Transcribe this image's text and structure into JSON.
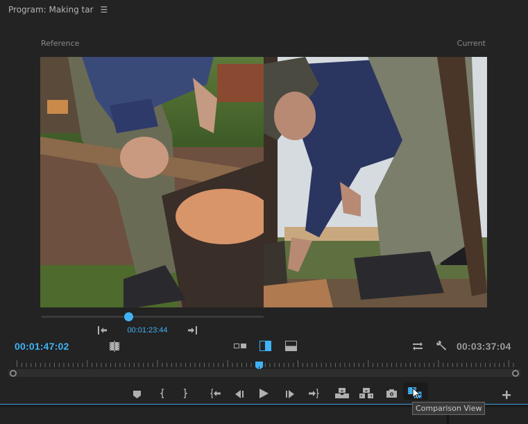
{
  "panel": {
    "title": "Program: Making tar",
    "menu_icon": "hamburger-menu-icon"
  },
  "comparison": {
    "reference_label": "Reference",
    "current_label": "Current",
    "reference_timecode": "00:01:23:44",
    "reference_scrub_position": 0.39
  },
  "timecodes": {
    "current": "00:01:47:02",
    "duration": "00:03:37:04"
  },
  "timeline": {
    "playhead_position": 0.49
  },
  "controls": {
    "ref_prev": "go-to-previous-edit-icon",
    "ref_next": "go-to-next-edit-icon",
    "frame_match": "shot-or-frame-comparison-icon",
    "side_by_side": "side-by-side-icon",
    "vertical_split": "vertical-split-icon",
    "horizontal_split": "horizontal-split-icon",
    "swap_sides": "swap-sides-icon",
    "settings": "wrench-icon"
  },
  "transport": [
    {
      "name": "add-marker-button",
      "icon": "marker-icon"
    },
    {
      "name": "mark-in-button",
      "icon": "mark-in-icon"
    },
    {
      "name": "mark-out-button",
      "icon": "mark-out-icon"
    },
    {
      "name": "go-to-in-button",
      "icon": "go-to-in-icon"
    },
    {
      "name": "step-back-button",
      "icon": "step-back-icon"
    },
    {
      "name": "play-button",
      "icon": "play-icon"
    },
    {
      "name": "step-forward-button",
      "icon": "step-forward-icon"
    },
    {
      "name": "go-to-out-button",
      "icon": "go-to-out-icon"
    },
    {
      "name": "lift-button",
      "icon": "lift-icon"
    },
    {
      "name": "extract-button",
      "icon": "extract-icon"
    },
    {
      "name": "export-frame-button",
      "icon": "camera-icon"
    },
    {
      "name": "comparison-view-button",
      "icon": "comparison-view-icon",
      "active": true
    },
    {
      "name": "button-editor-button",
      "icon": "plus-icon"
    }
  ],
  "tooltip": "Comparison View",
  "colors": {
    "accent": "#3fb3f5",
    "background": "#232323",
    "icon": "#b0b0b0"
  }
}
